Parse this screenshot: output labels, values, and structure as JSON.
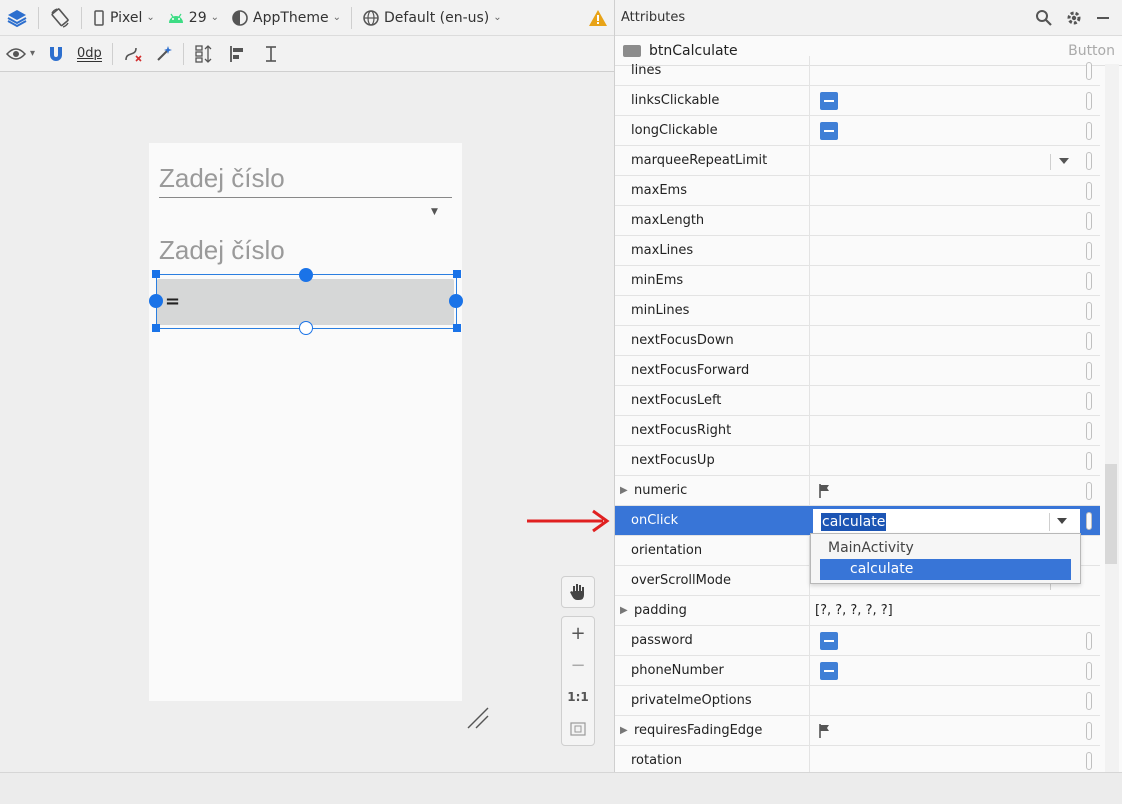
{
  "toolbar": {
    "device": "Pixel",
    "api_level": "29",
    "theme": "AppTheme",
    "locale": "Default (en-us)",
    "margin": "0dp"
  },
  "canvas": {
    "hint_first": "Zadej číslo",
    "hint_second": "Zadej číslo",
    "button_text": "=",
    "zoom_fit": "1:1"
  },
  "attributes": {
    "title": "Attributes",
    "component_name": "btnCalculate",
    "component_type": "Button",
    "rows": [
      {
        "name": "lines",
        "value": ""
      },
      {
        "name": "linksClickable",
        "value": ""
      },
      {
        "name": "longClickable",
        "value": ""
      },
      {
        "name": "marqueeRepeatLimit",
        "value": ""
      },
      {
        "name": "maxEms",
        "value": ""
      },
      {
        "name": "maxLength",
        "value": ""
      },
      {
        "name": "maxLines",
        "value": ""
      },
      {
        "name": "minEms",
        "value": ""
      },
      {
        "name": "minLines",
        "value": ""
      },
      {
        "name": "nextFocusDown",
        "value": ""
      },
      {
        "name": "nextFocusForward",
        "value": ""
      },
      {
        "name": "nextFocusLeft",
        "value": ""
      },
      {
        "name": "nextFocusRight",
        "value": ""
      },
      {
        "name": "nextFocusUp",
        "value": ""
      },
      {
        "name": "numeric",
        "value": ""
      },
      {
        "name": "onClick",
        "value": "calculate"
      },
      {
        "name": "orientation",
        "value": ""
      },
      {
        "name": "overScrollMode",
        "value": ""
      },
      {
        "name": "padding",
        "value": "[?, ?, ?, ?, ?]"
      },
      {
        "name": "password",
        "value": ""
      },
      {
        "name": "phoneNumber",
        "value": ""
      },
      {
        "name": "privateImeOptions",
        "value": ""
      },
      {
        "name": "requiresFadingEdge",
        "value": ""
      },
      {
        "name": "rotation",
        "value": ""
      }
    ],
    "onclick_popup": {
      "group": "MainActivity",
      "item": "calculate"
    }
  },
  "colors": {
    "accent": "#3875d7",
    "selection": "#1a73e8",
    "arrow": "#e02020"
  }
}
